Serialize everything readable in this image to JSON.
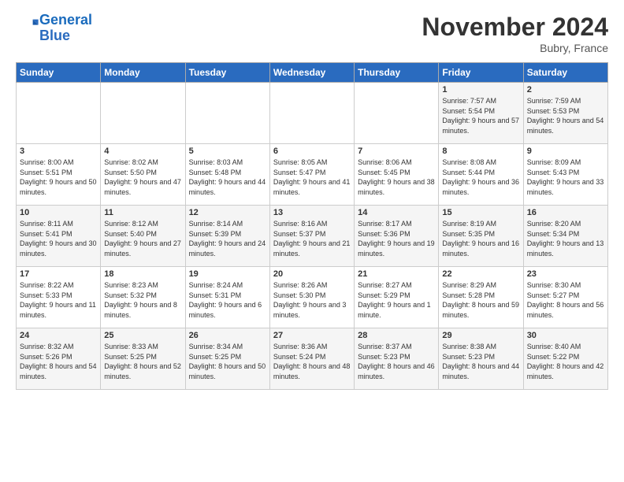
{
  "logo": {
    "line1": "General",
    "line2": "Blue"
  },
  "title": "November 2024",
  "location": "Bubry, France",
  "days_of_week": [
    "Sunday",
    "Monday",
    "Tuesday",
    "Wednesday",
    "Thursday",
    "Friday",
    "Saturday"
  ],
  "weeks": [
    [
      {
        "day": "",
        "info": ""
      },
      {
        "day": "",
        "info": ""
      },
      {
        "day": "",
        "info": ""
      },
      {
        "day": "",
        "info": ""
      },
      {
        "day": "",
        "info": ""
      },
      {
        "day": "1",
        "info": "Sunrise: 7:57 AM\nSunset: 5:54 PM\nDaylight: 9 hours and 57 minutes."
      },
      {
        "day": "2",
        "info": "Sunrise: 7:59 AM\nSunset: 5:53 PM\nDaylight: 9 hours and 54 minutes."
      }
    ],
    [
      {
        "day": "3",
        "info": "Sunrise: 8:00 AM\nSunset: 5:51 PM\nDaylight: 9 hours and 50 minutes."
      },
      {
        "day": "4",
        "info": "Sunrise: 8:02 AM\nSunset: 5:50 PM\nDaylight: 9 hours and 47 minutes."
      },
      {
        "day": "5",
        "info": "Sunrise: 8:03 AM\nSunset: 5:48 PM\nDaylight: 9 hours and 44 minutes."
      },
      {
        "day": "6",
        "info": "Sunrise: 8:05 AM\nSunset: 5:47 PM\nDaylight: 9 hours and 41 minutes."
      },
      {
        "day": "7",
        "info": "Sunrise: 8:06 AM\nSunset: 5:45 PM\nDaylight: 9 hours and 38 minutes."
      },
      {
        "day": "8",
        "info": "Sunrise: 8:08 AM\nSunset: 5:44 PM\nDaylight: 9 hours and 36 minutes."
      },
      {
        "day": "9",
        "info": "Sunrise: 8:09 AM\nSunset: 5:43 PM\nDaylight: 9 hours and 33 minutes."
      }
    ],
    [
      {
        "day": "10",
        "info": "Sunrise: 8:11 AM\nSunset: 5:41 PM\nDaylight: 9 hours and 30 minutes."
      },
      {
        "day": "11",
        "info": "Sunrise: 8:12 AM\nSunset: 5:40 PM\nDaylight: 9 hours and 27 minutes."
      },
      {
        "day": "12",
        "info": "Sunrise: 8:14 AM\nSunset: 5:39 PM\nDaylight: 9 hours and 24 minutes."
      },
      {
        "day": "13",
        "info": "Sunrise: 8:16 AM\nSunset: 5:37 PM\nDaylight: 9 hours and 21 minutes."
      },
      {
        "day": "14",
        "info": "Sunrise: 8:17 AM\nSunset: 5:36 PM\nDaylight: 9 hours and 19 minutes."
      },
      {
        "day": "15",
        "info": "Sunrise: 8:19 AM\nSunset: 5:35 PM\nDaylight: 9 hours and 16 minutes."
      },
      {
        "day": "16",
        "info": "Sunrise: 8:20 AM\nSunset: 5:34 PM\nDaylight: 9 hours and 13 minutes."
      }
    ],
    [
      {
        "day": "17",
        "info": "Sunrise: 8:22 AM\nSunset: 5:33 PM\nDaylight: 9 hours and 11 minutes."
      },
      {
        "day": "18",
        "info": "Sunrise: 8:23 AM\nSunset: 5:32 PM\nDaylight: 9 hours and 8 minutes."
      },
      {
        "day": "19",
        "info": "Sunrise: 8:24 AM\nSunset: 5:31 PM\nDaylight: 9 hours and 6 minutes."
      },
      {
        "day": "20",
        "info": "Sunrise: 8:26 AM\nSunset: 5:30 PM\nDaylight: 9 hours and 3 minutes."
      },
      {
        "day": "21",
        "info": "Sunrise: 8:27 AM\nSunset: 5:29 PM\nDaylight: 9 hours and 1 minute."
      },
      {
        "day": "22",
        "info": "Sunrise: 8:29 AM\nSunset: 5:28 PM\nDaylight: 8 hours and 59 minutes."
      },
      {
        "day": "23",
        "info": "Sunrise: 8:30 AM\nSunset: 5:27 PM\nDaylight: 8 hours and 56 minutes."
      }
    ],
    [
      {
        "day": "24",
        "info": "Sunrise: 8:32 AM\nSunset: 5:26 PM\nDaylight: 8 hours and 54 minutes."
      },
      {
        "day": "25",
        "info": "Sunrise: 8:33 AM\nSunset: 5:25 PM\nDaylight: 8 hours and 52 minutes."
      },
      {
        "day": "26",
        "info": "Sunrise: 8:34 AM\nSunset: 5:25 PM\nDaylight: 8 hours and 50 minutes."
      },
      {
        "day": "27",
        "info": "Sunrise: 8:36 AM\nSunset: 5:24 PM\nDaylight: 8 hours and 48 minutes."
      },
      {
        "day": "28",
        "info": "Sunrise: 8:37 AM\nSunset: 5:23 PM\nDaylight: 8 hours and 46 minutes."
      },
      {
        "day": "29",
        "info": "Sunrise: 8:38 AM\nSunset: 5:23 PM\nDaylight: 8 hours and 44 minutes."
      },
      {
        "day": "30",
        "info": "Sunrise: 8:40 AM\nSunset: 5:22 PM\nDaylight: 8 hours and 42 minutes."
      }
    ]
  ]
}
